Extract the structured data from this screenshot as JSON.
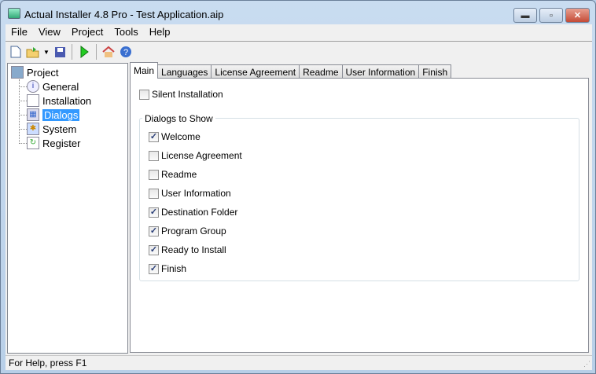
{
  "window": {
    "title": "Actual Installer 4.8 Pro - Test Application.aip",
    "minimize": "▬",
    "maximize": "▫",
    "close": "✕"
  },
  "menu": [
    "File",
    "View",
    "Project",
    "Tools",
    "Help"
  ],
  "tree": {
    "root": "Project",
    "items": [
      "General",
      "Installation",
      "Dialogs",
      "System",
      "Register"
    ],
    "selected": "Dialogs"
  },
  "tabs": [
    "Main",
    "Languages",
    "License Agreement",
    "Readme",
    "User Information",
    "Finish"
  ],
  "main": {
    "silent_label": "Silent Installation",
    "silent_checked": false,
    "group_label": "Dialogs to Show",
    "dialogs": [
      {
        "label": "Welcome",
        "checked": true
      },
      {
        "label": "License Agreement",
        "checked": false
      },
      {
        "label": "Readme",
        "checked": false
      },
      {
        "label": "User Information",
        "checked": false
      },
      {
        "label": "Destination Folder",
        "checked": true
      },
      {
        "label": "Program Group",
        "checked": true
      },
      {
        "label": "Ready to Install",
        "checked": true
      },
      {
        "label": "Finish",
        "checked": true
      }
    ]
  },
  "status": "For Help, press F1"
}
